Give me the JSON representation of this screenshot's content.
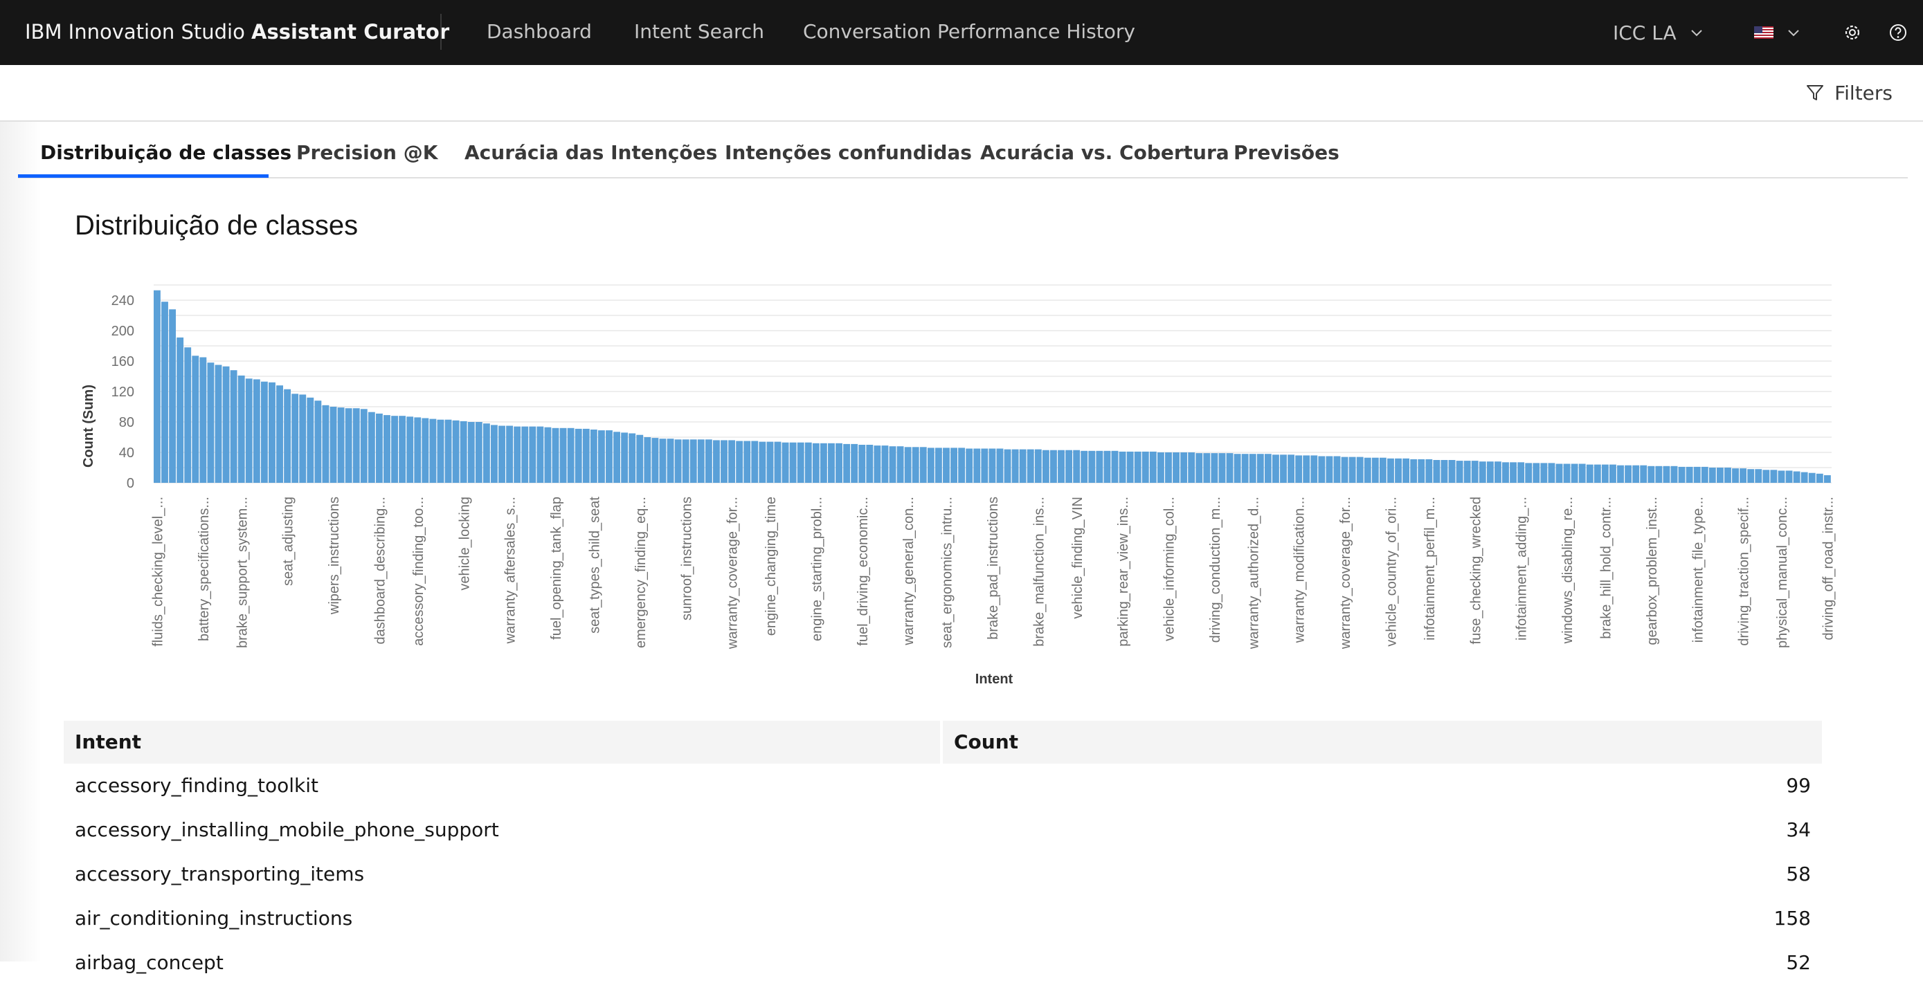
{
  "header": {
    "brand_prefix": "IBM Innovation Studio",
    "brand_name": "Assistant Curator",
    "nav": [
      "Dashboard",
      "Intent Search",
      "Conversation Performance History"
    ],
    "workspace": "ICC LA",
    "language_flag": "us-flag-icon",
    "settings_icon": "gear-icon",
    "help_icon": "help-icon"
  },
  "filters": {
    "label": "Filters",
    "icon": "filter-icon"
  },
  "tabs": [
    {
      "label": "Distribuição de classes",
      "active": true
    },
    {
      "label": "Precision @K",
      "active": false
    },
    {
      "label": "Acurácia das Intenções",
      "active": false
    },
    {
      "label": "Intenções confundidas",
      "active": false
    },
    {
      "label": "Acurácia vs. Cobertura",
      "active": false
    },
    {
      "label": "Previsões",
      "active": false
    }
  ],
  "panel": {
    "title": "Distribuição de classes"
  },
  "chart_data": {
    "type": "bar",
    "xlabel": "Intent",
    "ylabel": "Count (Sum)",
    "ylim": [
      0,
      260
    ],
    "yticks": [
      0,
      40,
      80,
      120,
      160,
      200,
      240
    ],
    "grid": true,
    "bar_color": "#5aa0d8",
    "x_tick_labels": [
      "fluids_checking_level_...",
      "battery_specifications...",
      "brake_support_system...",
      "seat_adjusting",
      "wipers_instructions",
      "dashboard_describing...",
      "accessory_finding_too...",
      "vehicle_locking",
      "warranty_aftersales_s...",
      "fuel_opening_tank_flap",
      "seat_types_child_seat",
      "emergency_finding_eq...",
      "sunroof_instructions",
      "warranty_coverage_for...",
      "engine_changing_time",
      "engine_starting_probl...",
      "fuel_driving_economic...",
      "warranty_general_con...",
      "seat_ergonomics_intru...",
      "brake_pad_instructions",
      "brake_malfunction_ins...",
      "vehicle_finding_VIN",
      "parking_rear_view_ins...",
      "vehicle_informing_col...",
      "driving_conduction_m...",
      "warranty_authorized_d...",
      "warranty_modification...",
      "warranty_coverage_for...",
      "vehicle_country_of_ori...",
      "infotainment_perfil_m...",
      "fuse_checking_wrecked",
      "infotainment_adding_...",
      "windows_disabling_re...",
      "brake_hill_hold_contr...",
      "gearbox_problem_inst...",
      "infotainment_file_type...",
      "driving_traction_specif...",
      "physical_manual_conc...",
      "driving_off_road_instr..."
    ],
    "values": [
      253,
      238,
      228,
      191,
      178,
      167,
      165,
      158,
      155,
      153,
      148,
      141,
      137,
      136,
      133,
      132,
      128,
      123,
      117,
      116,
      112,
      108,
      102,
      100,
      99,
      98,
      98,
      97,
      93,
      91,
      89,
      88,
      88,
      87,
      86,
      85,
      84,
      83,
      83,
      82,
      81,
      80,
      80,
      78,
      76,
      75,
      75,
      74,
      74,
      74,
      74,
      73,
      72,
      72,
      72,
      71,
      71,
      70,
      69,
      69,
      67,
      66,
      65,
      63,
      60,
      59,
      58,
      58,
      57,
      57,
      57,
      57,
      57,
      56,
      56,
      56,
      55,
      55,
      55,
      54,
      54,
      54,
      53,
      53,
      53,
      53,
      52,
      52,
      52,
      52,
      51,
      51,
      50,
      50,
      49,
      49,
      48,
      48,
      47,
      47,
      47,
      46,
      46,
      46,
      46,
      46,
      45,
      45,
      45,
      45,
      45,
      44,
      44,
      44,
      44,
      44,
      43,
      43,
      43,
      43,
      43,
      42,
      42,
      42,
      42,
      42,
      41,
      41,
      41,
      41,
      41,
      40,
      40,
      40,
      40,
      40,
      39,
      39,
      39,
      39,
      39,
      38,
      38,
      38,
      38,
      38,
      37,
      37,
      37,
      36,
      36,
      36,
      35,
      35,
      35,
      34,
      34,
      34,
      33,
      33,
      33,
      32,
      32,
      32,
      31,
      31,
      31,
      30,
      30,
      30,
      29,
      29,
      29,
      28,
      28,
      28,
      27,
      27,
      27,
      26,
      26,
      26,
      26,
      25,
      25,
      25,
      25,
      24,
      24,
      24,
      24,
      23,
      23,
      23,
      23,
      22,
      22,
      22,
      22,
      21,
      21,
      21,
      21,
      20,
      20,
      20,
      19,
      19,
      18,
      18,
      17,
      17,
      16,
      16,
      15,
      14,
      13,
      12,
      10
    ]
  },
  "table": {
    "headers": [
      "Intent",
      "Count"
    ],
    "rows": [
      {
        "intent": "accessory_finding_toolkit",
        "count": "99"
      },
      {
        "intent": "accessory_installing_mobile_phone_support",
        "count": "34"
      },
      {
        "intent": "accessory_transporting_items",
        "count": "58"
      },
      {
        "intent": "air_conditioning_instructions",
        "count": "158"
      },
      {
        "intent": "airbag_concept",
        "count": "52"
      }
    ]
  }
}
